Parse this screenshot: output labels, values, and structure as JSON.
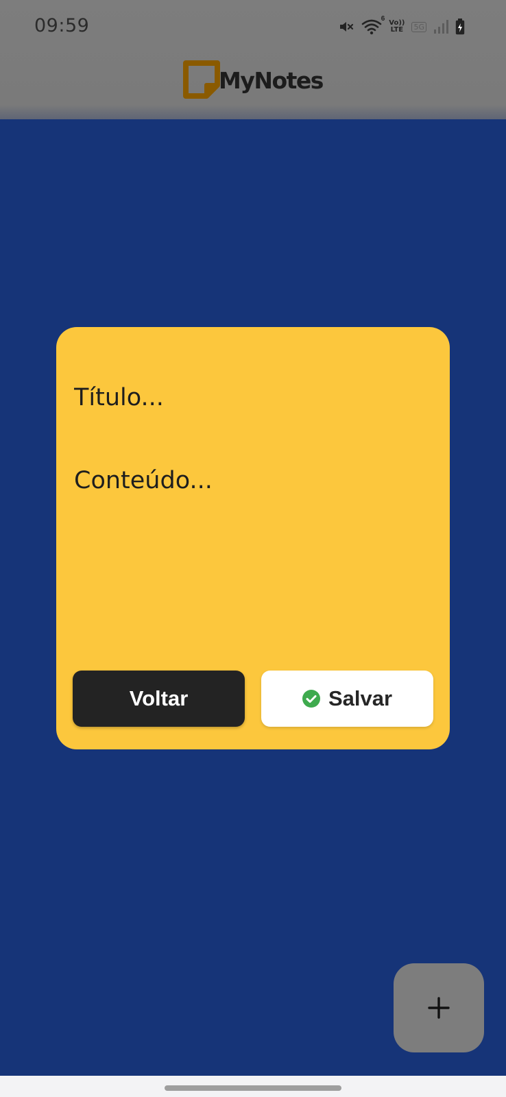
{
  "status_bar": {
    "time": "09:59",
    "icons": [
      "mute-icon",
      "wifi-icon",
      "volte-icon",
      "5g-icon",
      "signal-icon",
      "battery-charging-icon"
    ],
    "volte_top": "Vo))",
    "volte_bottom": "LTE",
    "wifi_badge": "6",
    "network_badge": "5G"
  },
  "app_bar": {
    "brand_name": "MyNotes",
    "logo_icon": "sticky-note-icon",
    "logo_color": "#8a5a00"
  },
  "dialog": {
    "title_placeholder": "Título...",
    "content_placeholder": "Conteúdo...",
    "back_label": "Voltar",
    "save_label": "Salvar",
    "save_icon": "check-circle-icon",
    "background_color": "#fcc73d"
  },
  "fab": {
    "icon": "plus-icon"
  },
  "colors": {
    "page_background": "#163478",
    "accent_check": "#3eaa4e",
    "back_button": "#232323"
  }
}
